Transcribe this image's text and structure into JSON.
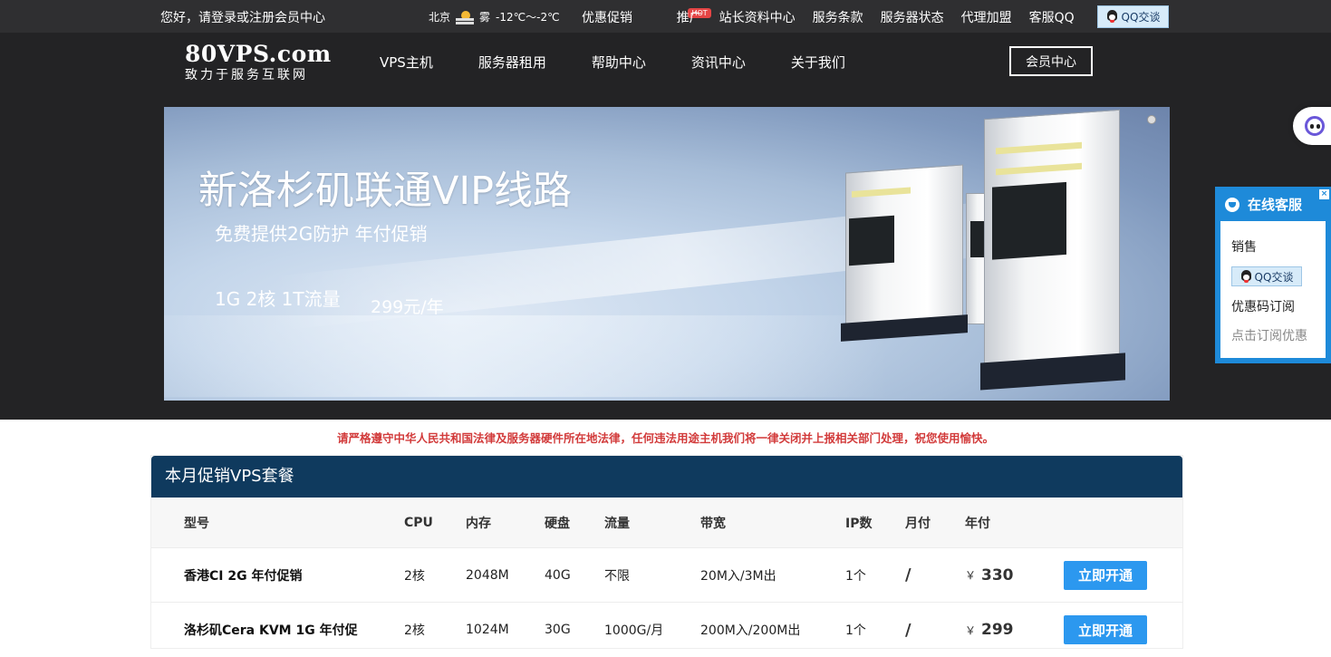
{
  "topbar": {
    "greeting": "您好，请登录或注册会员中心",
    "weather": {
      "city": "北京",
      "condition": "雾",
      "temperature": "-12℃～-2℃",
      "icon": "weather-fog-sun-icon"
    },
    "links": [
      "优惠促销",
      "推广",
      "站长资料中心",
      "服务条款",
      "服务器状态",
      "代理加盟",
      "客服QQ"
    ],
    "hot_badge": "HOT",
    "qq_button": "QQ交谈"
  },
  "header": {
    "logo_title": "80VPS.com",
    "logo_subtitle": "致力于服务互联网",
    "nav": [
      "VPS主机",
      "服务器租用",
      "帮助中心",
      "资讯中心",
      "关于我们"
    ],
    "member_button": "会员中心"
  },
  "banner": {
    "title": "新洛杉矶联通VIP线路",
    "subtitle": "免费提供2G防护 年付促销",
    "spec": "1G 2核 1T流量",
    "price": "299元/年"
  },
  "service_widget": {
    "title": "在线客服",
    "sales_label": "销售",
    "qq_button": "QQ交谈",
    "subscribe_title": "优惠码订阅",
    "subscribe_link": "点击订阅优惠"
  },
  "notice": "请严格遵守中华人民共和国法律及服务器硬件所在地法律，任何违法用途主机我们将一律关闭并上报相关部门处理，祝您使用愉快。",
  "promo": {
    "heading": "本月促销VPS套餐",
    "columns": [
      "型号",
      "CPU",
      "内存",
      "硬盘",
      "流量",
      "带宽",
      "IP数",
      "月付",
      "年付"
    ],
    "rows": [
      {
        "model": "香港CI 2G 年付促销",
        "cpu": "2核",
        "memory": "2048M",
        "disk": "40G",
        "traffic": "不限",
        "bandwidth": "20M入/3M出",
        "ips": "1个",
        "monthly": "/",
        "currency": "￥",
        "yearly": "330",
        "action": "立即开通"
      },
      {
        "model": "洛杉矶Cera KVM 1G 年付促",
        "cpu": "2核",
        "memory": "1024M",
        "disk": "30G",
        "traffic": "1000G/月",
        "bandwidth": "200M入/200M出",
        "ips": "1个",
        "monthly": "/",
        "currency": "￥",
        "yearly": "299",
        "action": "立即开通"
      }
    ]
  },
  "colors": {
    "topbar_bg": "#2f2f31",
    "header_bg": "#232325",
    "service_blue": "#1e8ad9",
    "table_head_bg": "#0f3a5e",
    "button_blue": "#2c98ef",
    "notice_red": "#d23b3b"
  }
}
